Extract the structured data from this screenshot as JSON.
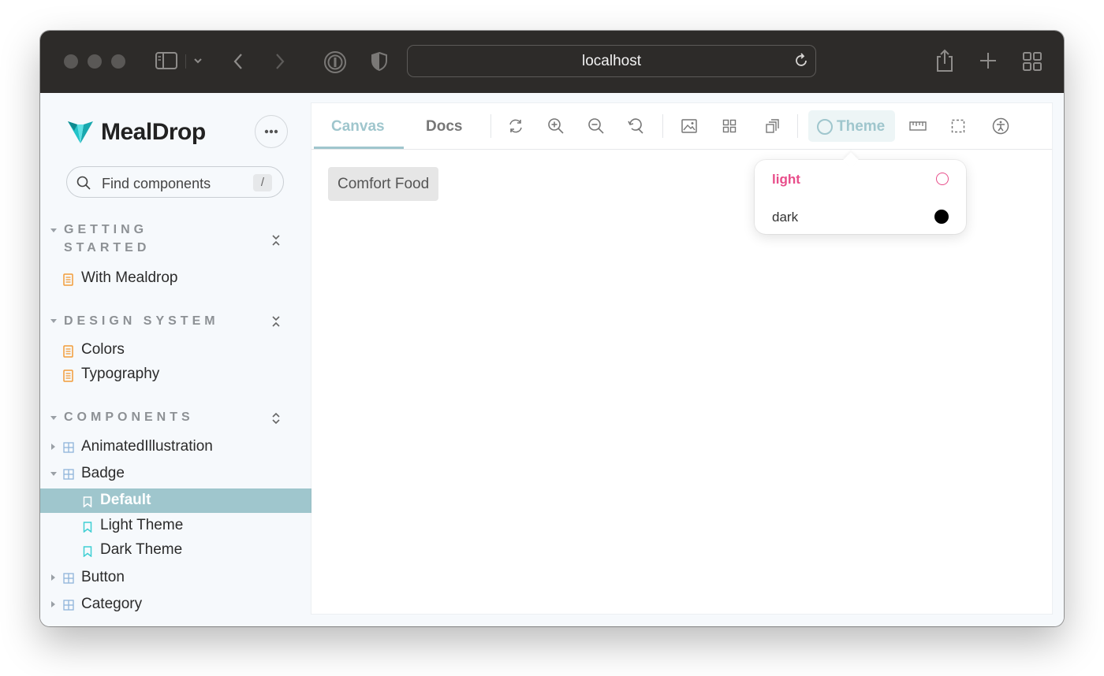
{
  "browser": {
    "url": "localhost"
  },
  "sidebar": {
    "logo_text": "MealDrop",
    "search_placeholder": "Find components",
    "search_shortcut": "/",
    "sections": [
      {
        "title_line1": "GETTING",
        "title_line2": "STARTED",
        "items": [
          "With Mealdrop"
        ]
      },
      {
        "title": "DESIGN SYSTEM",
        "items": [
          "Colors",
          "Typography"
        ]
      },
      {
        "title": "COMPONENTS",
        "items": [
          {
            "label": "AnimatedIllustration",
            "expanded": false
          },
          {
            "label": "Badge",
            "expanded": true,
            "stories": [
              "Default",
              "Light Theme",
              "Dark Theme"
            ],
            "selected_story": "Default"
          },
          {
            "label": "Button",
            "expanded": false
          },
          {
            "label": "Category",
            "expanded": false
          }
        ]
      }
    ]
  },
  "toolbar": {
    "tabs": [
      "Canvas",
      "Docs"
    ],
    "active_tab": "Canvas",
    "theme_label": "Theme"
  },
  "canvas": {
    "badge_text": "Comfort Food"
  },
  "theme_menu": {
    "options": [
      {
        "label": "light",
        "active": true,
        "swatch": "#ffffff",
        "swatch_border": "#e84d8a"
      },
      {
        "label": "dark",
        "active": false,
        "swatch": "#000000",
        "swatch_border": "#000000"
      }
    ]
  },
  "colors": {
    "accent": "#9fc6cd",
    "active_option": "#e84d8a",
    "doc_icon": "#f29c38",
    "story_icon": "#3fcfd3",
    "component_icon": "#8fb4d9"
  }
}
